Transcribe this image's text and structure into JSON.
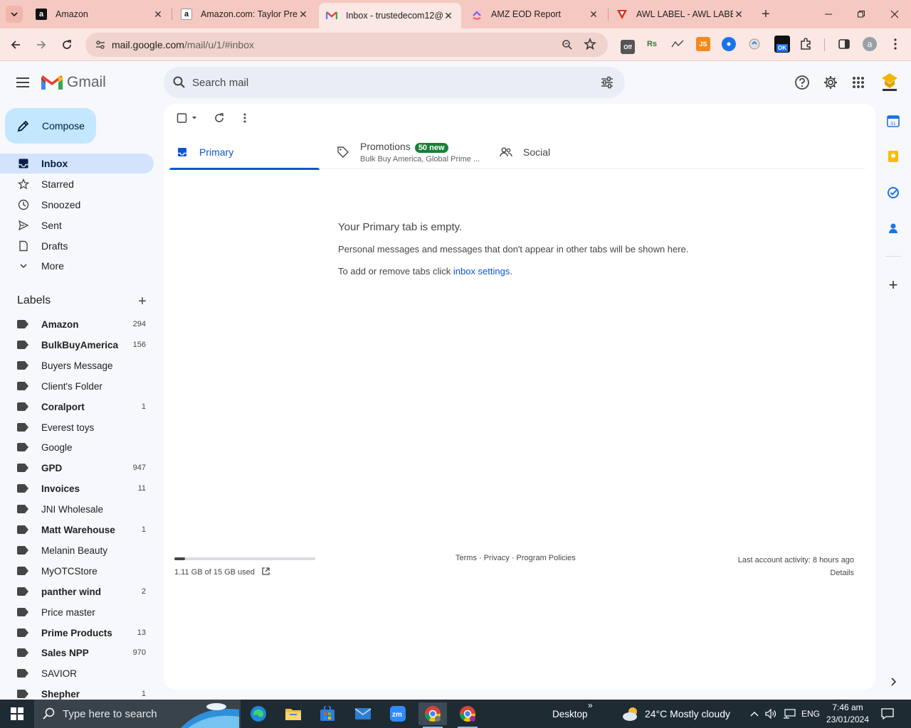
{
  "browser": {
    "tabs": [
      {
        "title": "Amazon",
        "favicon": "amazon-icon"
      },
      {
        "title": "Amazon.com: Taylor Prec",
        "favicon": "amazon-icon"
      },
      {
        "title": "Inbox - trustedecom12@",
        "favicon": "gmail-icon"
      },
      {
        "title": "AMZ EOD Report",
        "favicon": "clickup-icon"
      },
      {
        "title": "AWL LABEL - AWL LABEL",
        "favicon": "awl-icon"
      }
    ],
    "active_tab": 2,
    "url_host": "mail.google.com",
    "url_path": "/mail/u/1/#inbox",
    "profile_initial": "a",
    "ext_js": "JS",
    "ext_rs": "Rs",
    "ext_ok": "OK",
    "ext_off": "Off"
  },
  "gmail": {
    "logo_text": "Gmail",
    "search_placeholder": "Search mail",
    "compose_label": "Compose",
    "nav": [
      {
        "label": "Inbox",
        "icon": "inbox-icon"
      },
      {
        "label": "Starred",
        "icon": "star-icon"
      },
      {
        "label": "Snoozed",
        "icon": "clock-icon"
      },
      {
        "label": "Sent",
        "icon": "send-icon"
      },
      {
        "label": "Drafts",
        "icon": "draft-icon"
      },
      {
        "label": "More",
        "icon": "chevron-down-icon"
      }
    ],
    "labels_heading": "Labels",
    "labels": [
      {
        "name": "Amazon",
        "count": "294",
        "bold": true
      },
      {
        "name": "BulkBuyAmerica",
        "count": "156",
        "bold": true
      },
      {
        "name": "Buyers Message",
        "count": "",
        "bold": false
      },
      {
        "name": "Client's Folder",
        "count": "",
        "bold": false
      },
      {
        "name": "Coralport",
        "count": "1",
        "bold": true
      },
      {
        "name": "Everest toys",
        "count": "",
        "bold": false
      },
      {
        "name": "Google",
        "count": "",
        "bold": false
      },
      {
        "name": "GPD",
        "count": "947",
        "bold": true
      },
      {
        "name": "Invoices",
        "count": "11",
        "bold": true
      },
      {
        "name": "JNI Wholesale",
        "count": "",
        "bold": false
      },
      {
        "name": "Matt Warehouse",
        "count": "1",
        "bold": true
      },
      {
        "name": "Melanin Beauty",
        "count": "",
        "bold": false
      },
      {
        "name": "MyOTCStore",
        "count": "",
        "bold": false
      },
      {
        "name": "panther wind",
        "count": "2",
        "bold": true
      },
      {
        "name": "Price master",
        "count": "",
        "bold": false
      },
      {
        "name": "Prime Products",
        "count": "13",
        "bold": true
      },
      {
        "name": "Sales NPP",
        "count": "970",
        "bold": true
      },
      {
        "name": "SAVIOR",
        "count": "",
        "bold": false
      },
      {
        "name": "Shepher",
        "count": "1",
        "bold": true
      }
    ],
    "tabs": {
      "primary": "Primary",
      "promotions": "Promotions",
      "promotions_badge": "50 new",
      "promotions_sub": "Bulk Buy America, Global Prime ...",
      "social": "Social"
    },
    "empty": {
      "title": "Your Primary tab is empty.",
      "line1": "Personal messages and messages that don't appear in other tabs will be shown here.",
      "line2_prefix": "To add or remove tabs click ",
      "line2_link": "inbox settings",
      "line2_suffix": "."
    },
    "footer": {
      "storage": "1.11 GB of 15 GB used",
      "storage_fraction": 0.074,
      "links": "Terms · Privacy · Program Policies",
      "activity": "Last account activity: 8 hours ago",
      "details": "Details"
    }
  },
  "taskbar": {
    "search_placeholder": "Type here to search",
    "desktop_label": "Desktop",
    "weather": "24°C  Mostly cloudy",
    "language": "ENG",
    "time": "7:46 am",
    "date": "23/01/2024"
  },
  "colors": {
    "tabstrip": "#f5c9c1",
    "accent": "#0b57d0",
    "compose": "#c2e7ff",
    "active_nav": "#d3e3fd",
    "promo_badge": "#188038"
  }
}
